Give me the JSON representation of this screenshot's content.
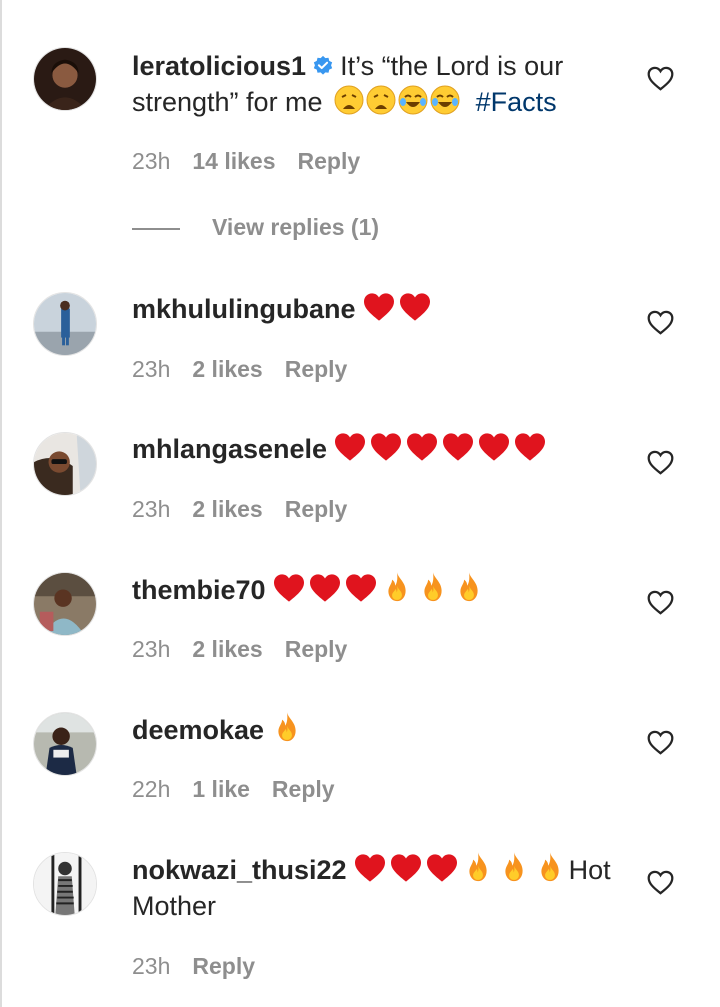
{
  "colors": {
    "text": "#262626",
    "meta": "#8e8e8e",
    "hashtag": "#00376b",
    "verified": "#3897f0",
    "heart_emoji": "#e0141e",
    "fire_outer": "#f7931e",
    "fire_inner": "#ffcc29"
  },
  "comments": [
    {
      "username": "leratolicious1",
      "verified": true,
      "text_line1": "It’s “the Lord is our",
      "text_line2": "strength” for me",
      "emojis": [
        "weary-face",
        "weary-face",
        "tears-of-joy",
        "tears-of-joy"
      ],
      "hashtag": "#Facts",
      "time": "23h",
      "likes": "14 likes",
      "reply": "Reply",
      "view_replies": "View replies (1)"
    },
    {
      "username": "mkhululingubane",
      "emojis": [
        "red-heart",
        "red-heart"
      ],
      "time": "23h",
      "likes": "2 likes",
      "reply": "Reply"
    },
    {
      "username": "mhlangasenele",
      "emojis": [
        "red-heart",
        "red-heart",
        "red-heart",
        "red-heart",
        "red-heart",
        "red-heart"
      ],
      "time": "23h",
      "likes": "2 likes",
      "reply": "Reply"
    },
    {
      "username": "thembie70",
      "emojis": [
        "red-heart",
        "red-heart",
        "red-heart",
        "fire",
        "fire",
        "fire"
      ],
      "time": "23h",
      "likes": "2 likes",
      "reply": "Reply"
    },
    {
      "username": "deemokae",
      "emojis": [
        "fire"
      ],
      "time": "22h",
      "likes": "1 like",
      "reply": "Reply"
    },
    {
      "username": "nokwazi_thusi22",
      "emojis": [
        "red-heart",
        "red-heart",
        "red-heart",
        "fire",
        "fire",
        "fire"
      ],
      "text_after": "Hot",
      "text_line2": "Mother",
      "time": "23h",
      "reply": "Reply"
    }
  ],
  "icons": {
    "like": "heart-outline-icon",
    "verified": "verified-badge-icon"
  }
}
